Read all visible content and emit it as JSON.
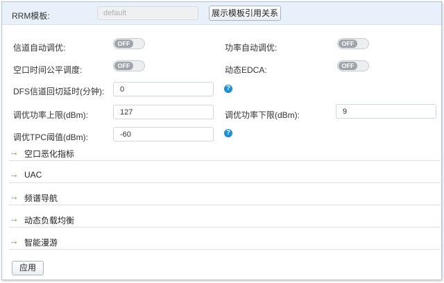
{
  "header": {
    "template_label": "RRM模板:",
    "template_value": "default",
    "show_refs_button": "展示模板引用关系"
  },
  "settings": {
    "channel_auto_tune": {
      "label": "信道自动调优:",
      "state": "OFF"
    },
    "power_auto_tune": {
      "label": "功率自动调优:",
      "state": "OFF"
    },
    "airtime_fair": {
      "label": "空口时间公平调度:",
      "state": "OFF"
    },
    "dynamic_edca": {
      "label": "动态EDCA:",
      "state": "OFF"
    },
    "dfs_delay": {
      "label": "DFS信道回切延时(分钟):",
      "value": "0"
    },
    "power_upper": {
      "label": "调优功率上限(dBm):",
      "value": "127"
    },
    "power_lower": {
      "label": "调优功率下限(dBm):",
      "value": "9"
    },
    "tpc_threshold": {
      "label": "调优TPC阈值(dBm):",
      "value": "-60"
    }
  },
  "sections": [
    {
      "title": "空口恶化指标"
    },
    {
      "title": "UAC"
    },
    {
      "title": "频谱导航"
    },
    {
      "title": "动态负载均衡"
    },
    {
      "title": "智能漫游"
    }
  ],
  "footer": {
    "apply_button": "应用"
  },
  "icons": {
    "help": "?",
    "expand_arrow": "→"
  },
  "colors": {
    "accent_green": "#5fae3b",
    "help_blue": "#1b8fd8",
    "header_bg": "#e8f1fa"
  }
}
